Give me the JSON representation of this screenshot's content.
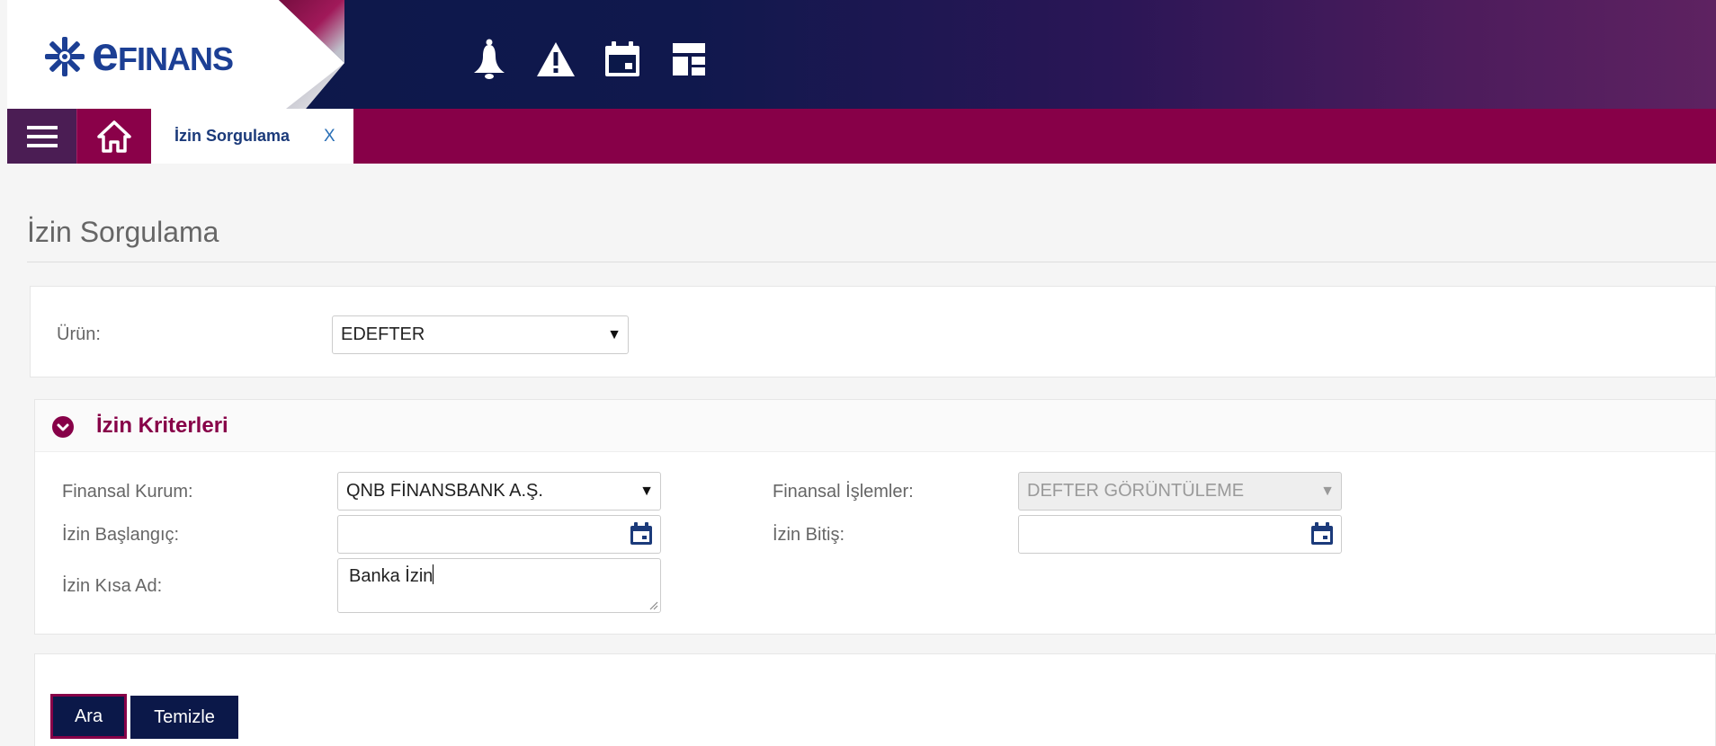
{
  "header": {
    "logo": {
      "e": "e",
      "rest": "FINANS"
    },
    "icons": [
      "bell-icon",
      "warning-icon",
      "calendar-icon",
      "layout-icon"
    ]
  },
  "tabs": {
    "active_tab": {
      "label": "İzin Sorgulama",
      "close": "X"
    }
  },
  "page": {
    "title": "İzin Sorgulama"
  },
  "product": {
    "label": "Ürün:",
    "value": "EDEFTER"
  },
  "criteria": {
    "title": "İzin Kriterleri",
    "financial_institution": {
      "label": "Finansal Kurum:",
      "value": "QNB FİNANSBANK A.Ş."
    },
    "financial_operations": {
      "label": "Finansal İşlemler:",
      "value": "DEFTER GÖRÜNTÜLEME"
    },
    "start": {
      "label": "İzin Başlangıç:",
      "value": ""
    },
    "end": {
      "label": "İzin Bitiş:",
      "value": ""
    },
    "short_name": {
      "label": "İzin Kısa Ad:",
      "value": "Banka İzin"
    }
  },
  "actions": {
    "search": "Ara",
    "clear": "Temizle"
  },
  "colors": {
    "navy": "#0b1849",
    "magenta": "#870048",
    "purple_dark": "#4b1d54",
    "logo_blue": "#1c3f94"
  }
}
